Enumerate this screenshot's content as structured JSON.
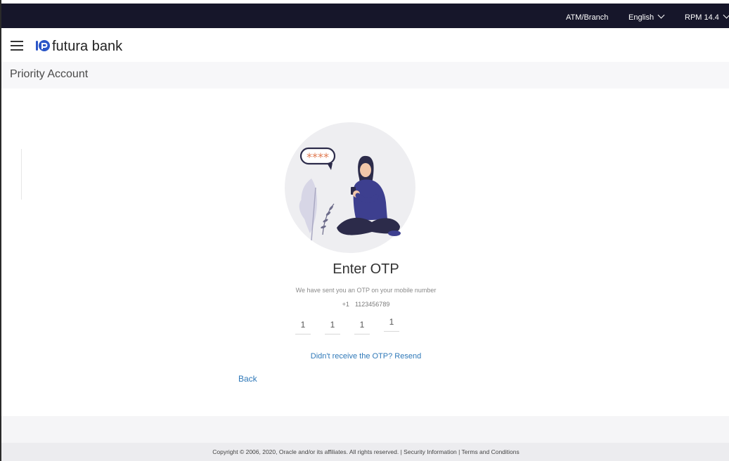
{
  "header": {
    "atm_branch": "ATM/Branch",
    "language": "English",
    "user": "RPM 14.4"
  },
  "brand": {
    "name": "futura bank",
    "logo_icon": "futura-logo-icon",
    "menu_icon": "hamburger-icon"
  },
  "page": {
    "title": "Priority Account"
  },
  "otp": {
    "heading": "Enter OTP",
    "message": "We have sent you an OTP on your mobile number",
    "country_code": "+1",
    "phone_number": "1123456789",
    "digits": [
      "1",
      "1",
      "1",
      "1"
    ],
    "resend_label": "Didn't receive the OTP? Resend",
    "back_label": "Back",
    "illustration_text": "****"
  },
  "footer": {
    "copyright": "Copyright © 2006, 2020, Oracle and/or its affiliates. All rights reserved. | Security Information | Terms and Conditions"
  },
  "colors": {
    "topbar": "#16162a",
    "link": "#2e78b8",
    "accent": "#e07a52"
  }
}
